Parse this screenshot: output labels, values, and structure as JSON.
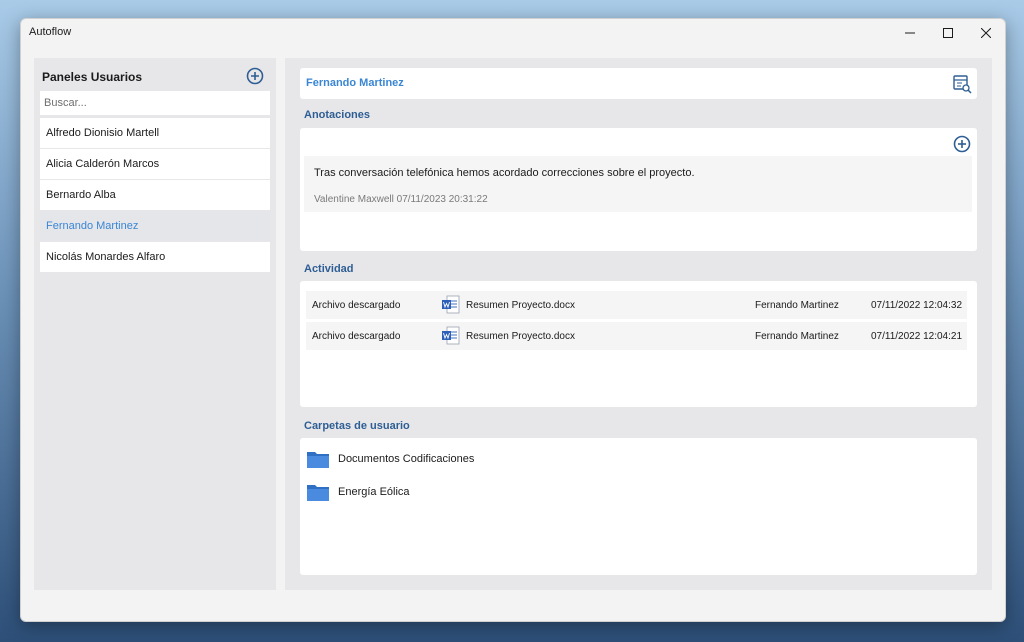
{
  "window": {
    "title": "Autoflow"
  },
  "sidebar": {
    "title": "Paneles Usuarios",
    "search_placeholder": "Buscar...",
    "users": [
      {
        "label": "Alfredo Dionisio Martell",
        "selected": false
      },
      {
        "label": "Alicia Calderón Marcos",
        "selected": false
      },
      {
        "label": "Bernardo Alba",
        "selected": false
      },
      {
        "label": "Fernando Martinez",
        "selected": true
      },
      {
        "label": "Nicolás Monardes Alfaro",
        "selected": false
      }
    ]
  },
  "profile": {
    "name": "Fernando Martinez"
  },
  "notes": {
    "title": "Anotaciones",
    "items": [
      {
        "text": "Tras conversación telefónica hemos acordado correcciones sobre el proyecto.",
        "meta": "Valentine Maxwell 07/11/2023 20:31:22"
      }
    ]
  },
  "activity": {
    "title": "Actividad",
    "rows": [
      {
        "action": "Archivo descargado",
        "file": "Resumen Proyecto.docx",
        "user": "Fernando Martinez",
        "date": "07/11/2022 12:04:32"
      },
      {
        "action": "Archivo descargado",
        "file": "Resumen Proyecto.docx",
        "user": "Fernando Martinez",
        "date": "07/11/2022 12:04:21"
      }
    ]
  },
  "folders": {
    "title": "Carpetas de usuario",
    "items": [
      {
        "label": "Documentos Codificaciones"
      },
      {
        "label": "Energía Eólica"
      }
    ]
  },
  "colors": {
    "accent": "#3a86d4",
    "section": "#2e5e93",
    "folder": "#3b7bd0",
    "word": "#2b5fb8"
  }
}
